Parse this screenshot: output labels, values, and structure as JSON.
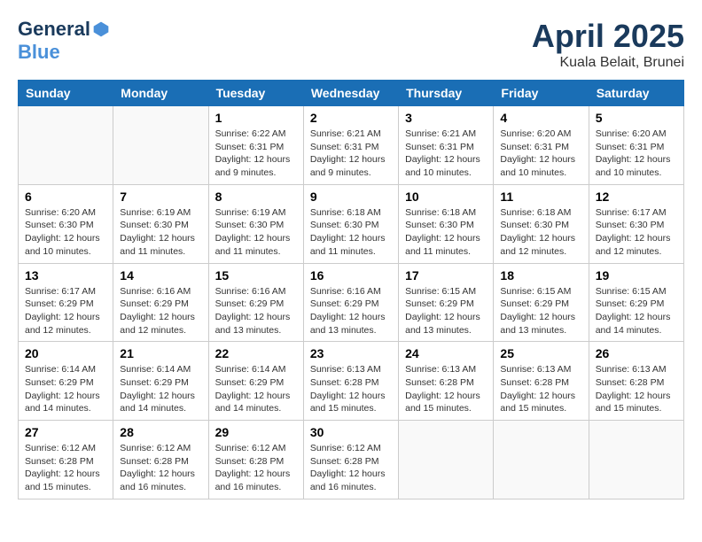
{
  "logo": {
    "general": "General",
    "blue": "Blue"
  },
  "title": {
    "month": "April 2025",
    "location": "Kuala Belait, Brunei"
  },
  "days_of_week": [
    "Sunday",
    "Monday",
    "Tuesday",
    "Wednesday",
    "Thursday",
    "Friday",
    "Saturday"
  ],
  "weeks": [
    [
      {
        "day": "",
        "info": ""
      },
      {
        "day": "",
        "info": ""
      },
      {
        "day": "1",
        "info": "Sunrise: 6:22 AM\nSunset: 6:31 PM\nDaylight: 12 hours and 9 minutes."
      },
      {
        "day": "2",
        "info": "Sunrise: 6:21 AM\nSunset: 6:31 PM\nDaylight: 12 hours and 9 minutes."
      },
      {
        "day": "3",
        "info": "Sunrise: 6:21 AM\nSunset: 6:31 PM\nDaylight: 12 hours and 10 minutes."
      },
      {
        "day": "4",
        "info": "Sunrise: 6:20 AM\nSunset: 6:31 PM\nDaylight: 12 hours and 10 minutes."
      },
      {
        "day": "5",
        "info": "Sunrise: 6:20 AM\nSunset: 6:31 PM\nDaylight: 12 hours and 10 minutes."
      }
    ],
    [
      {
        "day": "6",
        "info": "Sunrise: 6:20 AM\nSunset: 6:30 PM\nDaylight: 12 hours and 10 minutes."
      },
      {
        "day": "7",
        "info": "Sunrise: 6:19 AM\nSunset: 6:30 PM\nDaylight: 12 hours and 11 minutes."
      },
      {
        "day": "8",
        "info": "Sunrise: 6:19 AM\nSunset: 6:30 PM\nDaylight: 12 hours and 11 minutes."
      },
      {
        "day": "9",
        "info": "Sunrise: 6:18 AM\nSunset: 6:30 PM\nDaylight: 12 hours and 11 minutes."
      },
      {
        "day": "10",
        "info": "Sunrise: 6:18 AM\nSunset: 6:30 PM\nDaylight: 12 hours and 11 minutes."
      },
      {
        "day": "11",
        "info": "Sunrise: 6:18 AM\nSunset: 6:30 PM\nDaylight: 12 hours and 12 minutes."
      },
      {
        "day": "12",
        "info": "Sunrise: 6:17 AM\nSunset: 6:30 PM\nDaylight: 12 hours and 12 minutes."
      }
    ],
    [
      {
        "day": "13",
        "info": "Sunrise: 6:17 AM\nSunset: 6:29 PM\nDaylight: 12 hours and 12 minutes."
      },
      {
        "day": "14",
        "info": "Sunrise: 6:16 AM\nSunset: 6:29 PM\nDaylight: 12 hours and 12 minutes."
      },
      {
        "day": "15",
        "info": "Sunrise: 6:16 AM\nSunset: 6:29 PM\nDaylight: 12 hours and 13 minutes."
      },
      {
        "day": "16",
        "info": "Sunrise: 6:16 AM\nSunset: 6:29 PM\nDaylight: 12 hours and 13 minutes."
      },
      {
        "day": "17",
        "info": "Sunrise: 6:15 AM\nSunset: 6:29 PM\nDaylight: 12 hours and 13 minutes."
      },
      {
        "day": "18",
        "info": "Sunrise: 6:15 AM\nSunset: 6:29 PM\nDaylight: 12 hours and 13 minutes."
      },
      {
        "day": "19",
        "info": "Sunrise: 6:15 AM\nSunset: 6:29 PM\nDaylight: 12 hours and 14 minutes."
      }
    ],
    [
      {
        "day": "20",
        "info": "Sunrise: 6:14 AM\nSunset: 6:29 PM\nDaylight: 12 hours and 14 minutes."
      },
      {
        "day": "21",
        "info": "Sunrise: 6:14 AM\nSunset: 6:29 PM\nDaylight: 12 hours and 14 minutes."
      },
      {
        "day": "22",
        "info": "Sunrise: 6:14 AM\nSunset: 6:29 PM\nDaylight: 12 hours and 14 minutes."
      },
      {
        "day": "23",
        "info": "Sunrise: 6:13 AM\nSunset: 6:28 PM\nDaylight: 12 hours and 15 minutes."
      },
      {
        "day": "24",
        "info": "Sunrise: 6:13 AM\nSunset: 6:28 PM\nDaylight: 12 hours and 15 minutes."
      },
      {
        "day": "25",
        "info": "Sunrise: 6:13 AM\nSunset: 6:28 PM\nDaylight: 12 hours and 15 minutes."
      },
      {
        "day": "26",
        "info": "Sunrise: 6:13 AM\nSunset: 6:28 PM\nDaylight: 12 hours and 15 minutes."
      }
    ],
    [
      {
        "day": "27",
        "info": "Sunrise: 6:12 AM\nSunset: 6:28 PM\nDaylight: 12 hours and 15 minutes."
      },
      {
        "day": "28",
        "info": "Sunrise: 6:12 AM\nSunset: 6:28 PM\nDaylight: 12 hours and 16 minutes."
      },
      {
        "day": "29",
        "info": "Sunrise: 6:12 AM\nSunset: 6:28 PM\nDaylight: 12 hours and 16 minutes."
      },
      {
        "day": "30",
        "info": "Sunrise: 6:12 AM\nSunset: 6:28 PM\nDaylight: 12 hours and 16 minutes."
      },
      {
        "day": "",
        "info": ""
      },
      {
        "day": "",
        "info": ""
      },
      {
        "day": "",
        "info": ""
      }
    ]
  ]
}
